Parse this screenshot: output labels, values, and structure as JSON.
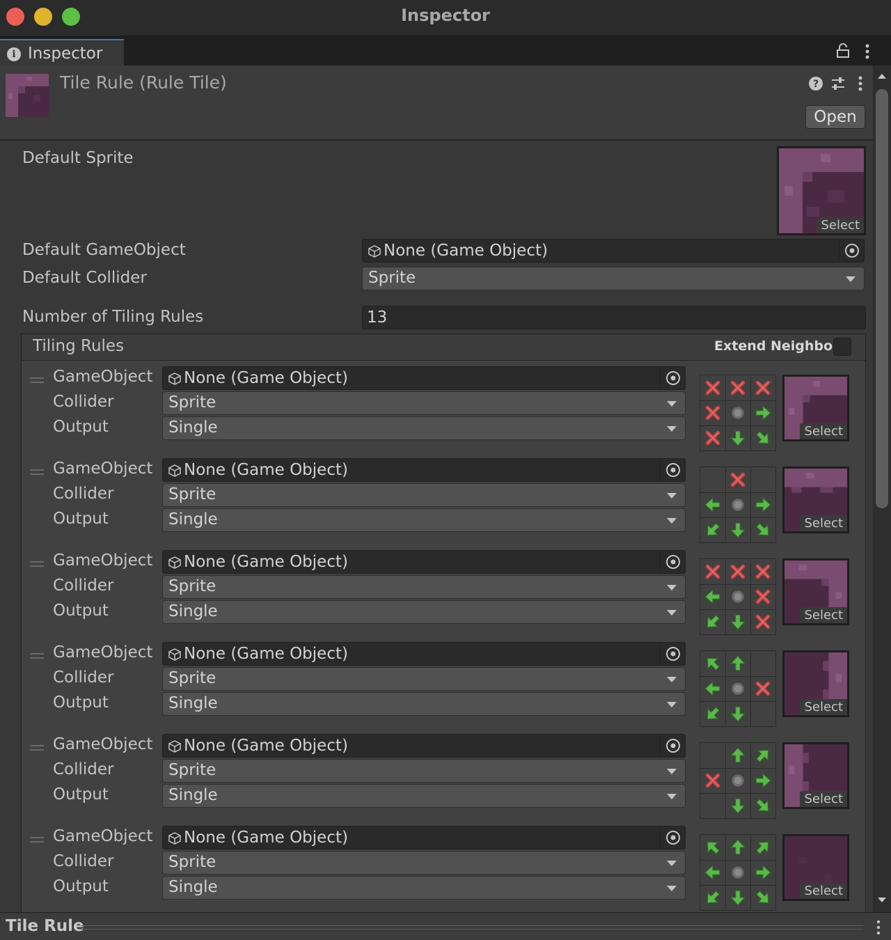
{
  "window": {
    "title": "Inspector",
    "tab_label": "Inspector",
    "tab_icon": "info-icon"
  },
  "header": {
    "asset_name": "Tile Rule (Rule Tile)",
    "open_label": "Open",
    "icons": [
      "help-icon",
      "presets-icon",
      "more-menu-icon"
    ]
  },
  "properties": {
    "default_sprite_label": "Default Sprite",
    "default_sprite_select": "Select",
    "default_gameobject_label": "Default GameObject",
    "default_gameobject_value": "None (Game Object)",
    "default_collider_label": "Default Collider",
    "default_collider_value": "Sprite",
    "num_rules_label": "Number of Tiling Rules",
    "num_rules_value": "13"
  },
  "tiling_rules": {
    "title": "Tiling Rules",
    "extend_neighbor_label": "Extend Neighbor",
    "extend_neighbor_checked": false,
    "field_labels": {
      "gameobject": "GameObject",
      "collider": "Collider",
      "output": "Output"
    },
    "select_label": "Select",
    "rules": [
      {
        "gameobject": "None (Game Object)",
        "collider": "Sprite",
        "output": "Single",
        "grid": [
          "x",
          "x",
          "x",
          "x",
          "c",
          "r",
          "x",
          "d",
          "dr"
        ],
        "sprite": "corner-tl"
      },
      {
        "gameobject": "None (Game Object)",
        "collider": "Sprite",
        "output": "Single",
        "grid": [
          "",
          "x",
          "",
          "l",
          "c",
          "r",
          "dl",
          "d",
          "dr"
        ],
        "sprite": "edge-top"
      },
      {
        "gameobject": "None (Game Object)",
        "collider": "Sprite",
        "output": "Single",
        "grid": [
          "x",
          "x",
          "x",
          "l",
          "c",
          "x",
          "dl",
          "d",
          "x"
        ],
        "sprite": "corner-tr"
      },
      {
        "gameobject": "None (Game Object)",
        "collider": "Sprite",
        "output": "Single",
        "grid": [
          "ul",
          "u",
          "",
          "l",
          "c",
          "x",
          "dl",
          "d",
          ""
        ],
        "sprite": "edge-right"
      },
      {
        "gameobject": "None (Game Object)",
        "collider": "Sprite",
        "output": "Single",
        "grid": [
          "",
          "u",
          "ur",
          "x",
          "c",
          "r",
          "",
          "d",
          "dr"
        ],
        "sprite": "edge-left"
      },
      {
        "gameobject": "None (Game Object)",
        "collider": "Sprite",
        "output": "Single",
        "grid": [
          "ul",
          "u",
          "ur",
          "l",
          "c",
          "r",
          "dl",
          "d",
          "dr"
        ],
        "sprite": "fill"
      }
    ]
  },
  "status": {
    "title": "Tile Rule"
  },
  "colors": {
    "accent_tab": "#3a79bb",
    "arrow_green": "#5bb84a",
    "cross_red": "#c84242",
    "tile_purple": "#6e4266",
    "close": "#ec5f57",
    "minimize": "#e0b32c",
    "maximize": "#5bc043"
  }
}
